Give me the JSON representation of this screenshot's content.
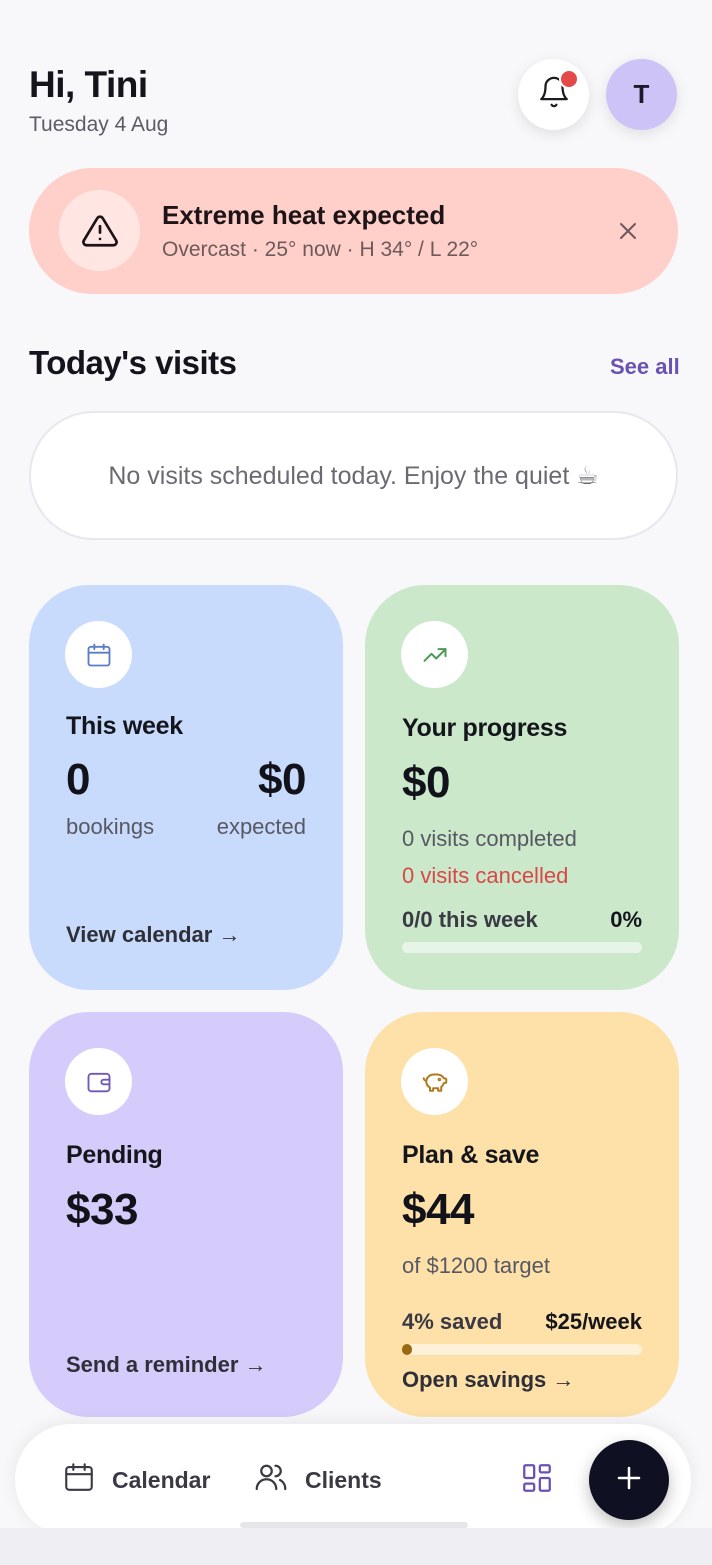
{
  "header": {
    "greeting": "Hi, Tini",
    "date": "Tuesday 4 Aug",
    "avatar_initial": "T",
    "notification_icon": "bell-icon",
    "has_unread": true
  },
  "alert": {
    "icon": "warning-icon",
    "title": "Extreme heat expected",
    "subtitle": "Overcast · 25° now · H 34° / L 22°",
    "close_icon": "close-icon"
  },
  "visits": {
    "title": "Today's visits",
    "see_all": "See all",
    "empty_message": "No visits scheduled today. Enjoy the quiet ☕"
  },
  "this_week": {
    "icon": "calendar-icon",
    "title": "This week",
    "bookings_value": "0",
    "bookings_label": "bookings",
    "expected_value": "$0",
    "expected_label": "expected",
    "link": "View calendar →"
  },
  "progress": {
    "icon": "trending-up-icon",
    "title": "Your progress",
    "amount": "$0",
    "completed": "0 visits completed",
    "cancelled": "0 visits cancelled",
    "week_label": "0/0 this week",
    "percent_label": "0%",
    "percent_fraction": 0
  },
  "pending": {
    "icon": "wallet-icon",
    "title": "Pending",
    "amount": "$33",
    "link": "Send a reminder →"
  },
  "savings": {
    "icon": "piggy-bank-icon",
    "title": "Plan & save",
    "amount": "$44",
    "target": "of $1200 target",
    "saved_label": "4% saved",
    "weekly_label": "$25/week",
    "saved_fraction": 0.04,
    "link": "Open savings →"
  },
  "bottom_nav": {
    "calendar_label": "Calendar",
    "clients_label": "Clients",
    "grid_icon": "grid-icon",
    "add_icon": "plus-icon"
  },
  "colors": {
    "accent": "#6a52b3",
    "alert_bg": "#ffcfc9",
    "week_bg": "#c8dbfc",
    "progress_bg": "#cbe8cb",
    "pending_bg": "#d6ccfb",
    "savings_bg": "#fde1a9",
    "cancelled_text": "#d94848",
    "fab_bg": "#0f1123"
  }
}
